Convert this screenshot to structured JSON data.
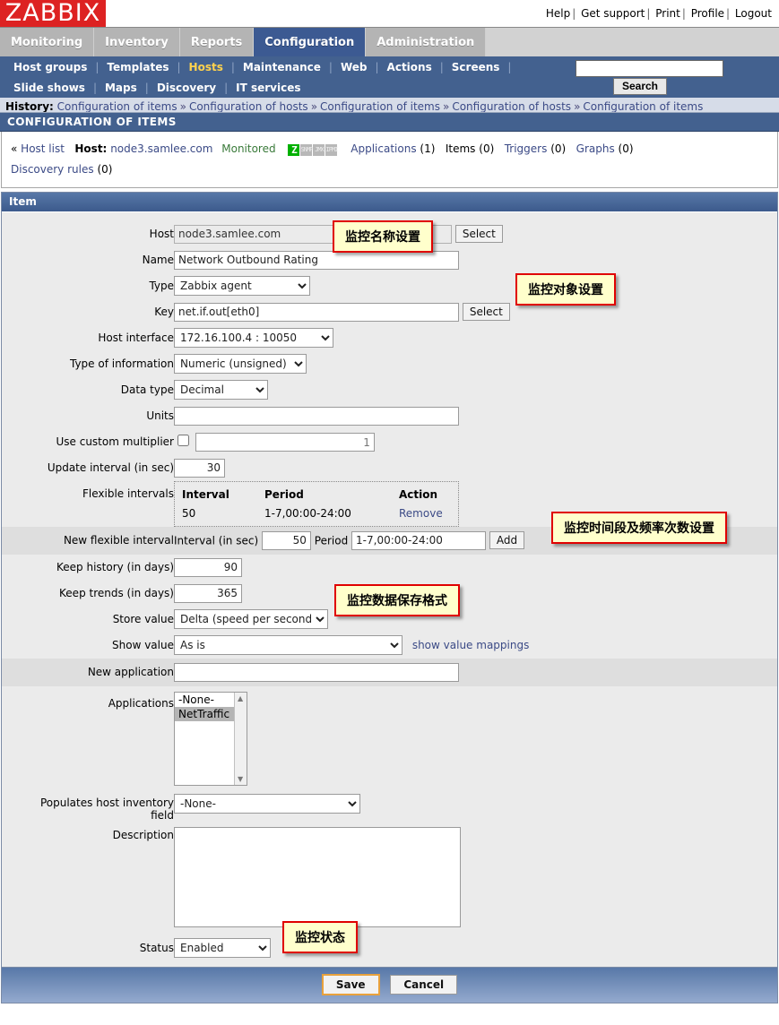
{
  "app": {
    "logo": "ZABBIX",
    "brand_color": "#dd2222"
  },
  "toplinks": [
    {
      "label": "Help"
    },
    {
      "label": "Get support"
    },
    {
      "label": "Print"
    },
    {
      "label": "Profile"
    },
    {
      "label": "Logout"
    }
  ],
  "mainmenu": {
    "tabs": [
      {
        "label": "Monitoring",
        "active": false
      },
      {
        "label": "Inventory",
        "active": false
      },
      {
        "label": "Reports",
        "active": false
      },
      {
        "label": "Configuration",
        "active": true
      },
      {
        "label": "Administration",
        "active": false
      }
    ],
    "active_color": "#3c5a92"
  },
  "submenu": {
    "row1": [
      "Host groups",
      "Templates",
      "Hosts",
      "Maintenance",
      "Web",
      "Actions",
      "Screens"
    ],
    "row2": [
      "Slide shows",
      "Maps",
      "Discovery",
      "IT services"
    ],
    "selected": "Hosts",
    "selected_color": "#ffd24d"
  },
  "search": {
    "value": "",
    "placeholder": "",
    "button_label": "Search"
  },
  "history": {
    "label": "History:",
    "items": [
      "Configuration of items",
      "Configuration of hosts",
      "Configuration of items",
      "Configuration of hosts",
      "Configuration of items"
    ],
    "separator": "»"
  },
  "page_title": "CONFIGURATION OF ITEMS",
  "hostinfo": {
    "back_label": "Host list",
    "back_arrow": "«",
    "host_label": "Host:",
    "host_name": "node3.samlee.com",
    "status": "Monitored",
    "status_color": "#3a7a3a",
    "icons": [
      {
        "name": "zabbix-agent-icon",
        "text": "Z",
        "enabled": true
      },
      {
        "name": "snmp-icon",
        "text": "SNMP",
        "enabled": false
      },
      {
        "name": "jmx-icon",
        "text": "JMX",
        "enabled": false
      },
      {
        "name": "ipmi-icon",
        "text": "IPMI",
        "enabled": false
      }
    ],
    "counters": [
      {
        "label": "Applications",
        "count": "(1)",
        "link": true
      },
      {
        "label": "Items",
        "count": "(0)",
        "link": false
      },
      {
        "label": "Triggers",
        "count": "(0)",
        "link": true
      },
      {
        "label": "Graphs",
        "count": "(0)",
        "link": true
      },
      {
        "label": "Discovery rules",
        "count": "(0)",
        "link": true
      }
    ]
  },
  "panel": {
    "title": "Item"
  },
  "form": {
    "host": {
      "label": "Host",
      "value": "node3.samlee.com",
      "select_label": "Select"
    },
    "name": {
      "label": "Name",
      "value": "Network Outbound Rating"
    },
    "type": {
      "label": "Type",
      "value": "Zabbix agent"
    },
    "key": {
      "label": "Key",
      "value": "net.if.out[eth0]",
      "select_label": "Select"
    },
    "host_interface": {
      "label": "Host interface",
      "value": "172.16.100.4 : 10050"
    },
    "type_of_information": {
      "label": "Type of information",
      "value": "Numeric (unsigned)"
    },
    "data_type": {
      "label": "Data type",
      "value": "Decimal"
    },
    "units": {
      "label": "Units",
      "value": ""
    },
    "use_custom_multiplier": {
      "label": "Use custom multiplier",
      "checked": false,
      "value": "",
      "placeholder": "1"
    },
    "update_interval": {
      "label": "Update interval (in sec)",
      "value": "30"
    },
    "flexible_intervals": {
      "label": "Flexible intervals",
      "headers": [
        "Interval",
        "Period",
        "Action"
      ],
      "rows": [
        {
          "interval": "50",
          "period": "1-7,00:00-24:00",
          "action": "Remove"
        }
      ]
    },
    "new_flexible_interval": {
      "label": "New flexible interval",
      "interval_label": "Interval (in sec)",
      "interval_value": "50",
      "period_label": "Period",
      "period_value": "1-7,00:00-24:00",
      "add_label": "Add"
    },
    "keep_history": {
      "label": "Keep history (in days)",
      "value": "90"
    },
    "keep_trends": {
      "label": "Keep trends (in days)",
      "value": "365"
    },
    "store_value": {
      "label": "Store value",
      "value": "Delta (speed per second)"
    },
    "show_value": {
      "label": "Show value",
      "value": "As is",
      "mappings_link": "show value mappings"
    },
    "new_application": {
      "label": "New application",
      "value": ""
    },
    "applications": {
      "label": "Applications",
      "options": [
        {
          "label": "-None-",
          "selected": false
        },
        {
          "label": "NetTraffic",
          "selected": true
        }
      ]
    },
    "host_inventory_field": {
      "label_line1": "Populates host inventory",
      "label_line2": "field",
      "value": "-None-"
    },
    "description": {
      "label": "Description",
      "value": ""
    },
    "status": {
      "label": "Status",
      "value": "Enabled"
    }
  },
  "callouts": [
    {
      "name": "name-setting",
      "text": "监控名称设置"
    },
    {
      "name": "object-setting",
      "text": "监控对象设置"
    },
    {
      "name": "interval-setting",
      "text": "监控时间段及频率次数设置"
    },
    {
      "name": "store-format-setting",
      "text": "监控数据保存格式"
    },
    {
      "name": "status-setting",
      "text": "监控状态"
    }
  ],
  "footer": {
    "save_label": "Save",
    "cancel_label": "Cancel"
  }
}
